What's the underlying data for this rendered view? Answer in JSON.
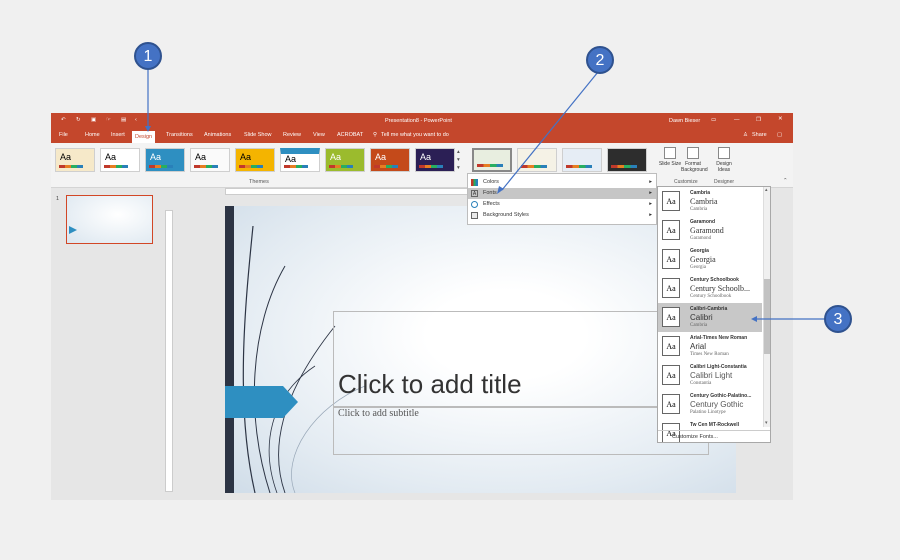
{
  "titlebar": {
    "title": "Presentation8  -  PowerPoint",
    "user": "Dawn Bieser",
    "qat_more": "‹"
  },
  "tabs": [
    {
      "label": "File"
    },
    {
      "label": "Home"
    },
    {
      "label": "Insert"
    },
    {
      "label": "Design",
      "active": true
    },
    {
      "label": "Transitions"
    },
    {
      "label": "Animations"
    },
    {
      "label": "Slide Show"
    },
    {
      "label": "Review"
    },
    {
      "label": "View"
    },
    {
      "label": "ACROBAT"
    },
    {
      "label": "Tell me what you want to do"
    }
  ],
  "share_label": "Share",
  "ribbon": {
    "themes_group_label": "Themes",
    "theme_sample": "Aa",
    "slide_size": "Slide Size",
    "format_background": "Format Background",
    "design_ideas": "Design Ideas",
    "customize_group_label": "Customize",
    "designer_group_label": "Designer"
  },
  "thumbnail": {
    "number": "1"
  },
  "slide": {
    "title_placeholder": "Click to add title",
    "subtitle_placeholder": "Click to add subtitle"
  },
  "design_menu": {
    "items": [
      {
        "label": "Colors",
        "icon": "palette-icon"
      },
      {
        "label": "Fonts",
        "icon": "font-icon",
        "highlighted": true
      },
      {
        "label": "Effects",
        "icon": "effects-icon"
      },
      {
        "label": "Background Styles",
        "icon": "background-icon"
      }
    ],
    "chevron": "▸"
  },
  "font_gallery": {
    "sample": "Aa",
    "items": [
      {
        "name": "Cambria",
        "heading": "Cambria",
        "body": "Cambria"
      },
      {
        "name": "Garamond",
        "heading": "Garamond",
        "body": "Garamond"
      },
      {
        "name": "Georgia",
        "heading": "Georgia",
        "body": "Georgia"
      },
      {
        "name": "Century Schoolbook",
        "heading": "Century Schoolb...",
        "body": "Century Schoolbook"
      },
      {
        "name": "Calibri-Cambria",
        "heading": "Calibri",
        "body": "Cambria",
        "selected": true
      },
      {
        "name": "Arial-Times New Roman",
        "heading": "Arial",
        "body": "Times New Roman"
      },
      {
        "name": "Calibri Light-Constantia",
        "heading": "Calibri Light",
        "body": "Constantia"
      },
      {
        "name": "Century Gothic-Palatino...",
        "heading": "Century Gothic",
        "body": "Palatino Linotype"
      },
      {
        "name": "Tw Cen MT-Rockwell",
        "heading": "",
        "body": ""
      }
    ],
    "customize_label": "Customize Fonts..."
  },
  "callouts": [
    {
      "number": "1"
    },
    {
      "number": "2"
    },
    {
      "number": "3"
    }
  ],
  "colors": {
    "accent": "#c4472c",
    "callout": "#4472c4",
    "slide_arrow": "#2e8fc1"
  }
}
